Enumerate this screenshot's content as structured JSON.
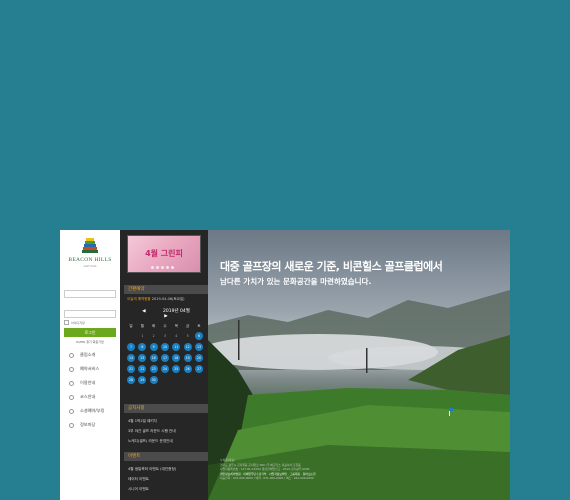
{
  "logo": {
    "brand": "BEACON HILLS",
    "sub": "Golf Club"
  },
  "login": {
    "id_placeholder": "",
    "pw_placeholder": "",
    "save_id": "아이디저장",
    "login_button": "로그인",
    "find_links": "ID/PW 찾기  회원가입"
  },
  "menu": [
    {
      "label": "클럽소개",
      "icon": "flag-icon"
    },
    {
      "label": "예약서비스",
      "icon": "calendar-icon"
    },
    {
      "label": "이용안내",
      "icon": "info-icon"
    },
    {
      "label": "코스안내",
      "icon": "course-icon"
    },
    {
      "label": "소셜예약/부킹",
      "icon": "social-icon"
    },
    {
      "label": "정보마당",
      "icon": "board-icon"
    }
  ],
  "banner": {
    "text": "4월 그린피"
  },
  "reservation": {
    "title": "간편예약",
    "today_label": "오늘의 예약현황",
    "today_value": "2019-04-06(토요일)",
    "month": "2019년 04월",
    "prev": "◀",
    "next": "▶",
    "weekdays": [
      "일",
      "월",
      "화",
      "수",
      "목",
      "금",
      "토"
    ],
    "weeks": [
      [
        "",
        "1",
        "2",
        "3",
        "4",
        "5",
        "6"
      ],
      [
        "7",
        "8",
        "9",
        "10",
        "11",
        "12",
        "13"
      ],
      [
        "14",
        "15",
        "16",
        "17",
        "18",
        "19",
        "20"
      ],
      [
        "21",
        "22",
        "23",
        "24",
        "25",
        "26",
        "27"
      ],
      [
        "28",
        "29",
        "30",
        "",
        "",
        "",
        ""
      ]
    ]
  },
  "notice": {
    "title": "공지사항",
    "items": [
      "4월 1박2일 패키지",
      "3부 야간 골프 라운드 시행 안내",
      "노캐디(셀프) 라운드 운영안내"
    ]
  },
  "event": {
    "title": "이벤트",
    "items": [
      "4월 생일축하 이벤트 (대인증정)",
      "테이터 이벤트",
      "시니어 이벤트"
    ]
  },
  "hero": {
    "headline": "대중 골프장의 새로운 기준, 비콘힐스 골프클럽에서",
    "subline": "남다른 가치가 있는 문화공간을 마련하였습니다."
  },
  "footer": {
    "lines": [
      "누리꿈(대표)",
      "경기도 광주시 곤지암읍 곤지암로 000 (주)비콘힐스 대표이사 홍길동",
      "사업자등록번호 : 127-81-XXXXX 통신판매업신고 : 2019-경기광주-0000",
      "개인정보처리방침 · 이메일무단수집거부 · 사업자정보확인 · 그룹제휴 · 찾아오는길",
      "대표전화 : 031-000-0000 / 예약 : 031-000-0000 / 팩스 : 031-000-0000"
    ]
  }
}
